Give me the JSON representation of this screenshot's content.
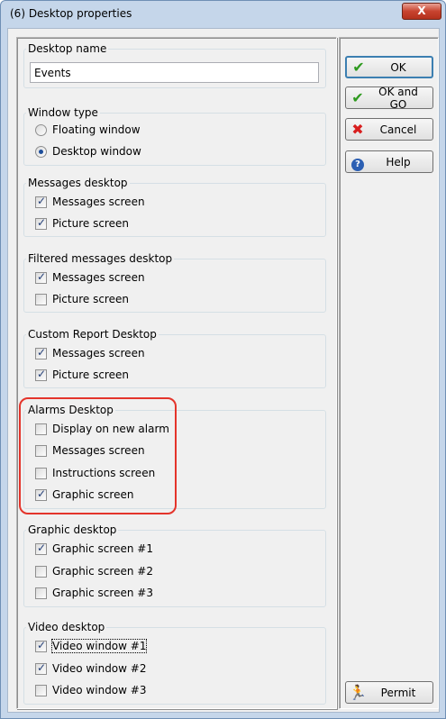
{
  "window": {
    "title": "(6)  Desktop properties",
    "close_label": "X"
  },
  "desktop_name": {
    "legend": "Desktop name",
    "value": "Events"
  },
  "window_type": {
    "legend": "Window type",
    "options": [
      "Floating window",
      "Desktop window"
    ],
    "selected": "Desktop window"
  },
  "messages_desktop": {
    "legend": "Messages desktop",
    "items": [
      {
        "label": "Messages screen",
        "checked": true
      },
      {
        "label": "Picture screen",
        "checked": true
      }
    ]
  },
  "filtered_messages_desktop": {
    "legend": "Filtered messages desktop",
    "items": [
      {
        "label": "Messages screen",
        "checked": true
      },
      {
        "label": "Picture screen",
        "checked": false
      }
    ]
  },
  "custom_report_desktop": {
    "legend": "Custom Report Desktop",
    "items": [
      {
        "label": "Messages screen",
        "checked": true
      },
      {
        "label": "Picture screen",
        "checked": true
      }
    ]
  },
  "alarms_desktop": {
    "legend": "Alarms Desktop",
    "items": [
      {
        "label": "Display on new alarm",
        "checked": false
      },
      {
        "label": "Messages screen",
        "checked": false
      },
      {
        "label": "Instructions screen",
        "checked": false
      },
      {
        "label": "Graphic screen",
        "checked": true
      }
    ]
  },
  "graphic_desktop": {
    "legend": "Graphic desktop",
    "items": [
      {
        "label": "Graphic screen #1",
        "checked": true
      },
      {
        "label": "Graphic screen #2",
        "checked": false
      },
      {
        "label": "Graphic screen #3",
        "checked": false
      }
    ]
  },
  "video_desktop": {
    "legend": "Video desktop",
    "items": [
      {
        "label": "Video window #1",
        "checked": true
      },
      {
        "label": "Video window #2",
        "checked": true
      },
      {
        "label": "Video window #3",
        "checked": false
      }
    ]
  },
  "buttons": {
    "ok": "OK",
    "ok_and_go": "OK and GO",
    "cancel": "Cancel",
    "help": "Help",
    "permit": "Permit"
  },
  "colors": {
    "highlight": "#e4342b",
    "check_green": "#2e9a1f",
    "cancel_red": "#d81e1e"
  }
}
